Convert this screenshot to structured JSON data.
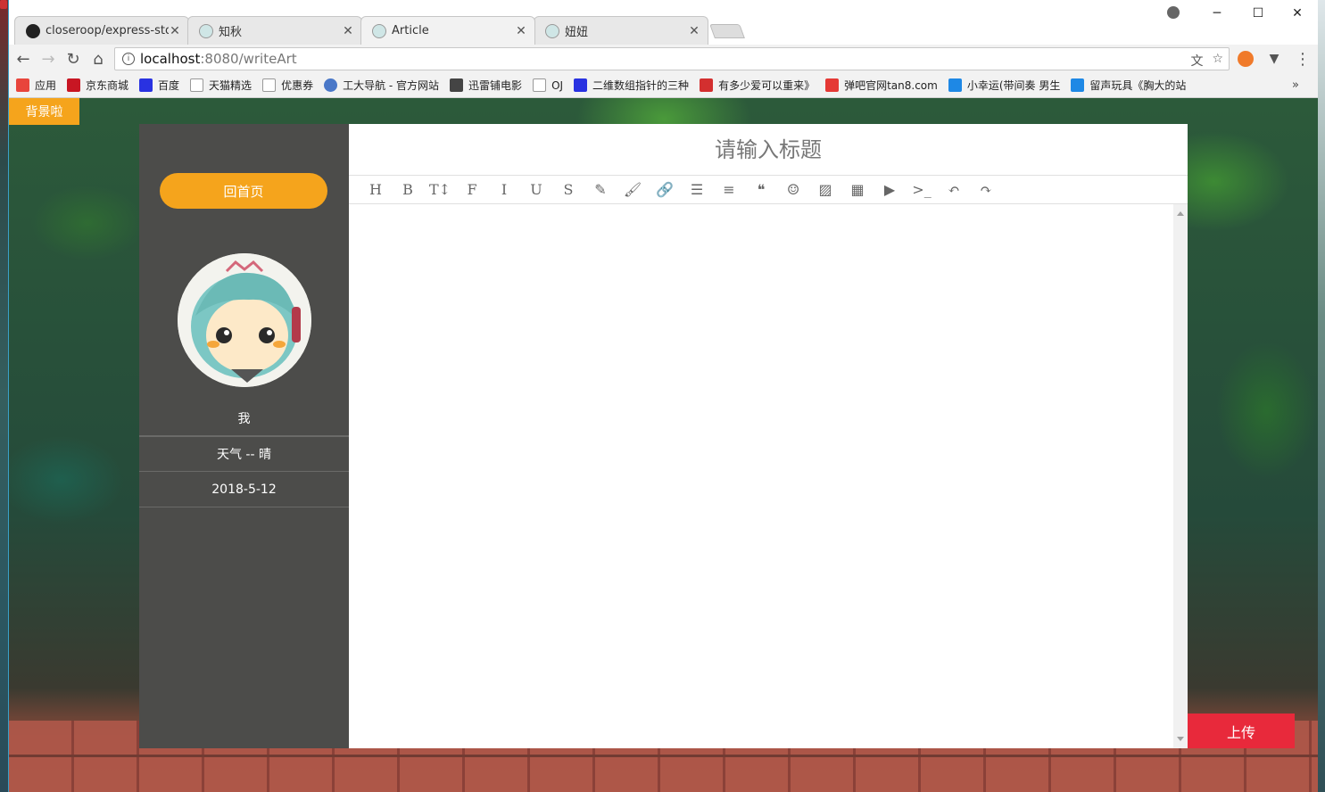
{
  "browser": {
    "tabs": [
      {
        "label": "closeroop/express-stor",
        "icon": "github-icon"
      },
      {
        "label": "知秋",
        "icon": "anime-avatar-icon"
      },
      {
        "label": "Article",
        "icon": "anime-avatar-icon",
        "active": true
      },
      {
        "label": "妞妞",
        "icon": "anime-avatar-icon"
      }
    ],
    "url_host": "localhost",
    "url_path": ":8080/writeArt",
    "bookmarks": [
      {
        "label": "应用",
        "color": "#e8453c"
      },
      {
        "label": "京东商城",
        "color": "#c81623"
      },
      {
        "label": "百度",
        "color": "#2932e1"
      },
      {
        "label": "天猫精选",
        "color": "#9e9e9e"
      },
      {
        "label": "优惠券",
        "color": "#9e9e9e"
      },
      {
        "label": "工大导航 - 官方网站",
        "color": "#4a78c8"
      },
      {
        "label": "迅雷铺电影",
        "color": "#444444"
      },
      {
        "label": "OJ",
        "color": "#9e9e9e"
      },
      {
        "label": "二维数组指针的三种",
        "color": "#2932e1"
      },
      {
        "label": "有多少爱可以重来》",
        "color": "#d32f2f"
      },
      {
        "label": "弹吧官网tan8.com",
        "color": "#e53935"
      },
      {
        "label": "小幸运(带间奏 男生",
        "color": "#1e88e5"
      },
      {
        "label": "留声玩具《胸大的站",
        "color": "#1e88e5"
      }
    ],
    "bookmarks_more": "»"
  },
  "page": {
    "bg_toggle_label": "背景啦",
    "home_button": "回首页",
    "user_name": "我",
    "weather": "天气 -- 晴",
    "date": "2018-5-12",
    "title_placeholder": "请输入标题",
    "upload_button": "上传",
    "accent": "#f5a41c",
    "upload_color": "#e8293b",
    "sidebar_color": "#4c4c4a"
  },
  "editor_tools": [
    {
      "name": "heading-icon",
      "glyph": "H"
    },
    {
      "name": "bold-icon",
      "glyph": "B"
    },
    {
      "name": "font-size-icon",
      "glyph": "T↕"
    },
    {
      "name": "font-family-icon",
      "glyph": "F"
    },
    {
      "name": "italic-icon",
      "glyph": "I"
    },
    {
      "name": "underline-icon",
      "glyph": "U"
    },
    {
      "name": "strikethrough-icon",
      "glyph": "S"
    },
    {
      "name": "highlight-icon",
      "glyph": "✎"
    },
    {
      "name": "brush-icon",
      "glyph": "🖌"
    },
    {
      "name": "link-icon",
      "glyph": "🔗"
    },
    {
      "name": "bullet-list-icon",
      "glyph": "☰"
    },
    {
      "name": "align-icon",
      "glyph": "≡"
    },
    {
      "name": "quote-icon",
      "glyph": "❝"
    },
    {
      "name": "emoji-icon",
      "glyph": "☺"
    },
    {
      "name": "image-icon",
      "glyph": "▨"
    },
    {
      "name": "table-icon",
      "glyph": "▦"
    },
    {
      "name": "video-icon",
      "glyph": "▶"
    },
    {
      "name": "code-icon",
      "glyph": ">_"
    },
    {
      "name": "undo-icon",
      "glyph": "↶"
    },
    {
      "name": "redo-icon",
      "glyph": "↷"
    }
  ]
}
